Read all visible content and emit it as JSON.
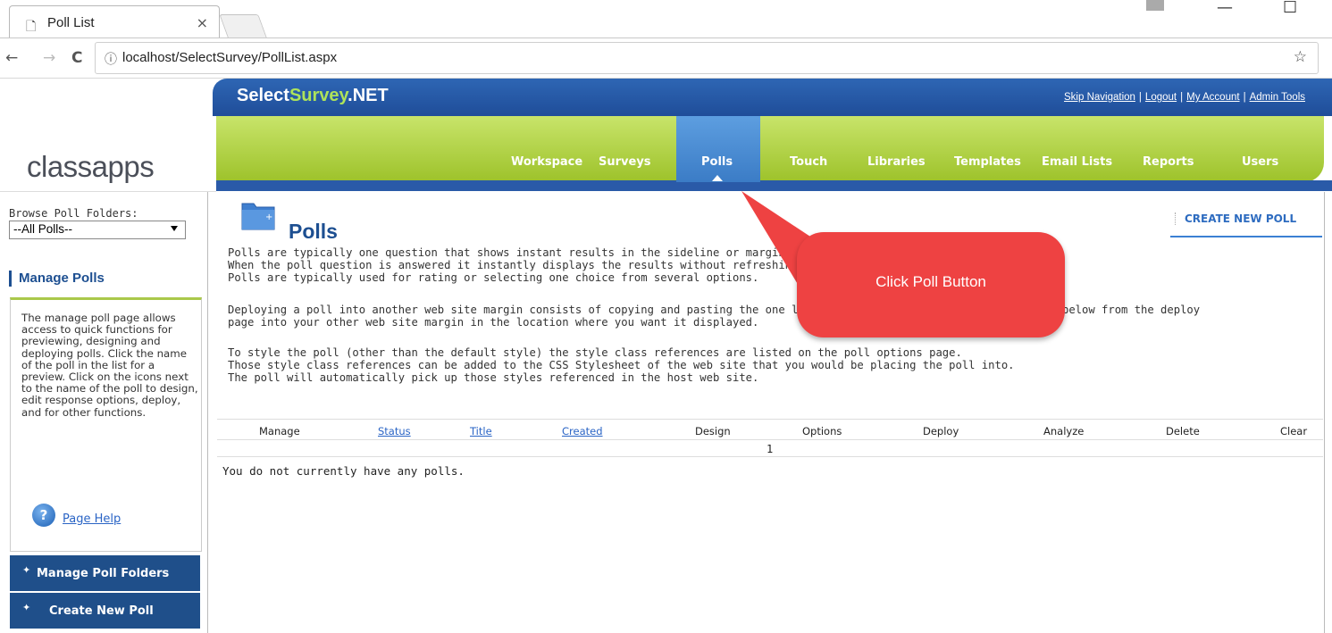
{
  "browser": {
    "tab_title": "Poll List",
    "tab_close": "×",
    "url": "localhost/SelectSurvey/PollList.aspx",
    "back": "←",
    "forward": "→",
    "reload": "C",
    "info": "ⓘ",
    "bookmark": "☆",
    "minimize": "—",
    "maximize": "☐"
  },
  "header": {
    "brand_prefix": "Select",
    "brand_highlight": "Survey",
    "brand_suffix": ".NET",
    "links": [
      "Skip Navigation",
      "Logout",
      "My Account",
      "Admin Tools"
    ],
    "nav": [
      "Workspace",
      "Surveys",
      "Polls",
      "Touch",
      "Libraries",
      "Templates",
      "Email Lists",
      "Reports",
      "Users"
    ],
    "selected_nav": "Polls",
    "logo_text": "classapps"
  },
  "sidebar": {
    "browse_label": "Browse Poll Folders:",
    "folder_value": "--All Polls--",
    "manage_heading": "Manage Polls",
    "help_text": "The manage poll page allows access to quick functions for previewing, designing and deploying polls. Click the name of the poll in the list for a preview. Click on the icons next to the name of the poll to design, edit response options, deploy, and for other functions.",
    "page_help": "Page Help",
    "buttons": [
      "Manage Poll Folders",
      "Create New Poll"
    ]
  },
  "main": {
    "title": "Polls",
    "create_new": "CREATE NEW POLL",
    "intro_lines": [
      "Polls are typically one question that shows instant results in the sideline or margin of a w",
      "When the poll question is answered it instantly displays the results without refreshing the",
      "Polls are typically used for rating or selecting one choice from several options.",
      "",
      "Deploying a poll into another web site margin consists of copying and pasting the one line",
      "page into your other web site margin in the location where you want it displayed.",
      "",
      "To style the poll (other than the default style) the style class references are listed on the poll options page.",
      "Those style class references can be added to the CSS Stylesheet of the web site that you would be placing the poll into.",
      "The poll will automatically pick up those styles referenced in the host web site."
    ],
    "intro_tail": "below from the deploy",
    "columns": [
      "Manage",
      "Status",
      "Title",
      "Created",
      "Design",
      "Options",
      "Deploy",
      "Analyze",
      "Delete",
      "Clear"
    ],
    "page_number": "1",
    "empty_message": "You do not currently have any polls."
  },
  "callout": {
    "text": "Click Poll Button",
    "color": "#ee4242"
  }
}
